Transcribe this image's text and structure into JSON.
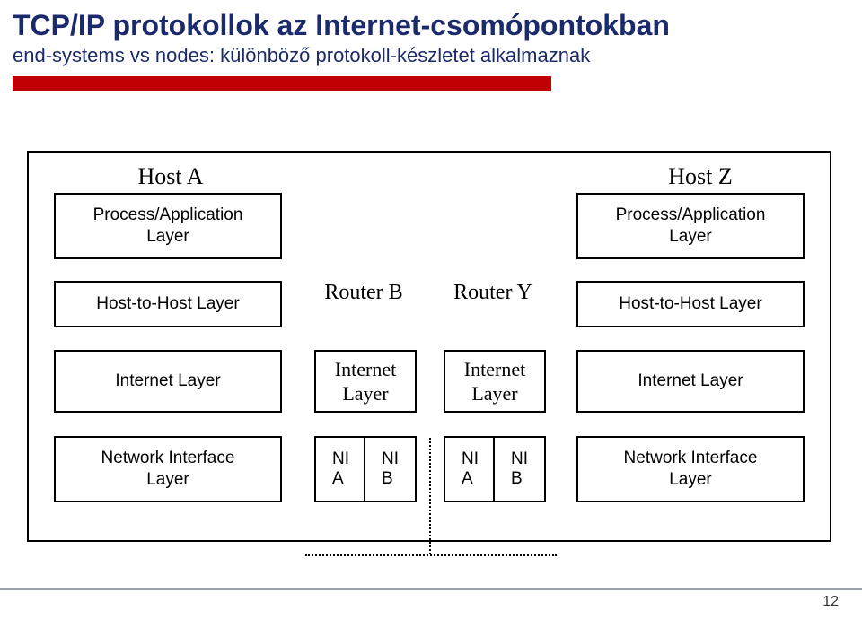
{
  "title": "TCP/IP protokollok az Internet-csomópontokban",
  "subtitle": "end-systems vs nodes: különböző protokoll-készletet alkalmaznak",
  "hostA": {
    "label": "Host A"
  },
  "hostZ": {
    "label": "Host Z"
  },
  "routerB": {
    "label": "Router B"
  },
  "routerY": {
    "label": "Router Y"
  },
  "layers": {
    "processApp": "Process/Application\nLayer",
    "h2h": "Host-to-Host Layer",
    "internet": "Internet Layer",
    "internetShort": "Internet\nLayer",
    "ni": "Network Interface\nLayer",
    "niA": "NI\nA",
    "niB": "NI\nB"
  },
  "pageNumber": "12"
}
